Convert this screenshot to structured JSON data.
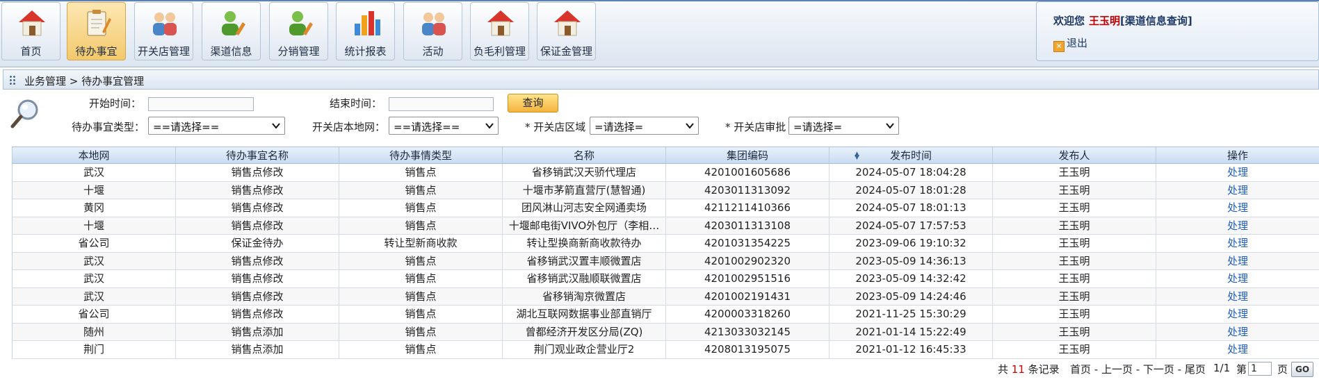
{
  "nav": [
    {
      "label": "首页",
      "icon": "home-icon"
    },
    {
      "label": "待办事宜",
      "icon": "clipboard-icon",
      "active": true
    },
    {
      "label": "开关店管理",
      "icon": "users-icon"
    },
    {
      "label": "渠道信息",
      "icon": "user-edit-icon"
    },
    {
      "label": "分销管理",
      "icon": "user-edit-icon"
    },
    {
      "label": "统计报表",
      "icon": "bar-chart-icon"
    },
    {
      "label": "活动",
      "icon": "users-icon"
    },
    {
      "label": "负毛利管理",
      "icon": "home-icon"
    },
    {
      "label": "保证金管理",
      "icon": "home-icon"
    }
  ],
  "welcome": {
    "greeting": "欢迎您",
    "user": "王玉明",
    "role": "[渠道信息查询]",
    "logout": "退出"
  },
  "breadcrumb": "业务管理 > 待办事宜管理",
  "filter": {
    "start_label": "开始时间：",
    "end_label": "结束时间：",
    "query_button": "查询",
    "type_label": "待办事宜类型：",
    "type_value": "==请选择==",
    "local_net_label": "开关店本地网：",
    "local_net_value": "==请选择==",
    "region_label": "* 开关店区域",
    "region_value": "=请选择=",
    "approval_label": "* 开关店审批",
    "approval_value": "=请选择="
  },
  "table": {
    "columns": [
      "本地网",
      "待办事宜名称",
      "待办事情类型",
      "名称",
      "集团编码",
      "发布时间",
      "发布人",
      "操作"
    ],
    "rows": [
      [
        "武汉",
        "销售点修改",
        "销售点",
        "省移销武汉天骄代理店",
        "4201001605686",
        "2024-05-07 18:04:28",
        "王玉明",
        "处理"
      ],
      [
        "十堰",
        "销售点修改",
        "销售点",
        "十堰市茅箭直营厅(慧智通)",
        "4203011313092",
        "2024-05-07 18:01:28",
        "王玉明",
        "处理"
      ],
      [
        "黄冈",
        "销售点修改",
        "销售点",
        "团风淋山河志安全网通卖场",
        "4211211410366",
        "2024-05-07 18:01:13",
        "王玉明",
        "处理"
      ],
      [
        "十堰",
        "销售点修改",
        "销售点",
        "十堰邮电街VIVO外包厅（李相…",
        "4203011313108",
        "2024-05-07 17:57:53",
        "王玉明",
        "处理"
      ],
      [
        "省公司",
        "保证金待办",
        "转让型新商收款",
        "转让型换商新商收款待办",
        "4201031354225",
        "2023-09-06 19:10:32",
        "王玉明",
        "处理"
      ],
      [
        "武汉",
        "销售点修改",
        "销售点",
        "省移销武汉置丰顺微置店",
        "4201002902320",
        "2023-05-09 14:36:13",
        "王玉明",
        "处理"
      ],
      [
        "武汉",
        "销售点修改",
        "销售点",
        "省移销武汉融顺联微置店",
        "4201002951516",
        "2023-05-09 14:32:42",
        "王玉明",
        "处理"
      ],
      [
        "武汉",
        "销售点修改",
        "销售点",
        "省移销淘京微置店",
        "4201002191431",
        "2023-05-09 14:24:46",
        "王玉明",
        "处理"
      ],
      [
        "省公司",
        "销售点修改",
        "销售点",
        "湖北互联网数据事业部直销厅",
        "4200003318260",
        "2021-11-25 15:30:29",
        "王玉明",
        "处理"
      ],
      [
        "随州",
        "销售点添加",
        "销售点",
        "曾都经济开发区分局(ZQ)",
        "4213033032145",
        "2021-01-14 15:22:49",
        "王玉明",
        "处理"
      ],
      [
        "荆门",
        "销售点添加",
        "销售点",
        "荆门观业政企营业厅2",
        "4208013195075",
        "2021-01-12 16:45:33",
        "王玉明",
        "处理"
      ]
    ]
  },
  "pager": {
    "total_prefix": "共",
    "total_count": "11",
    "total_suffix": "条记录",
    "links": "首页 - 上一页 - 下一页 - 尾页",
    "page_info": "1/1",
    "goto_prefix": "第",
    "current_page": "1",
    "goto_suffix": "页",
    "go_label": "GO"
  },
  "colors": {
    "accent_blue": "#1f5fbf",
    "highlight_red": "#d00000",
    "button_orange": "#f4b33c"
  }
}
